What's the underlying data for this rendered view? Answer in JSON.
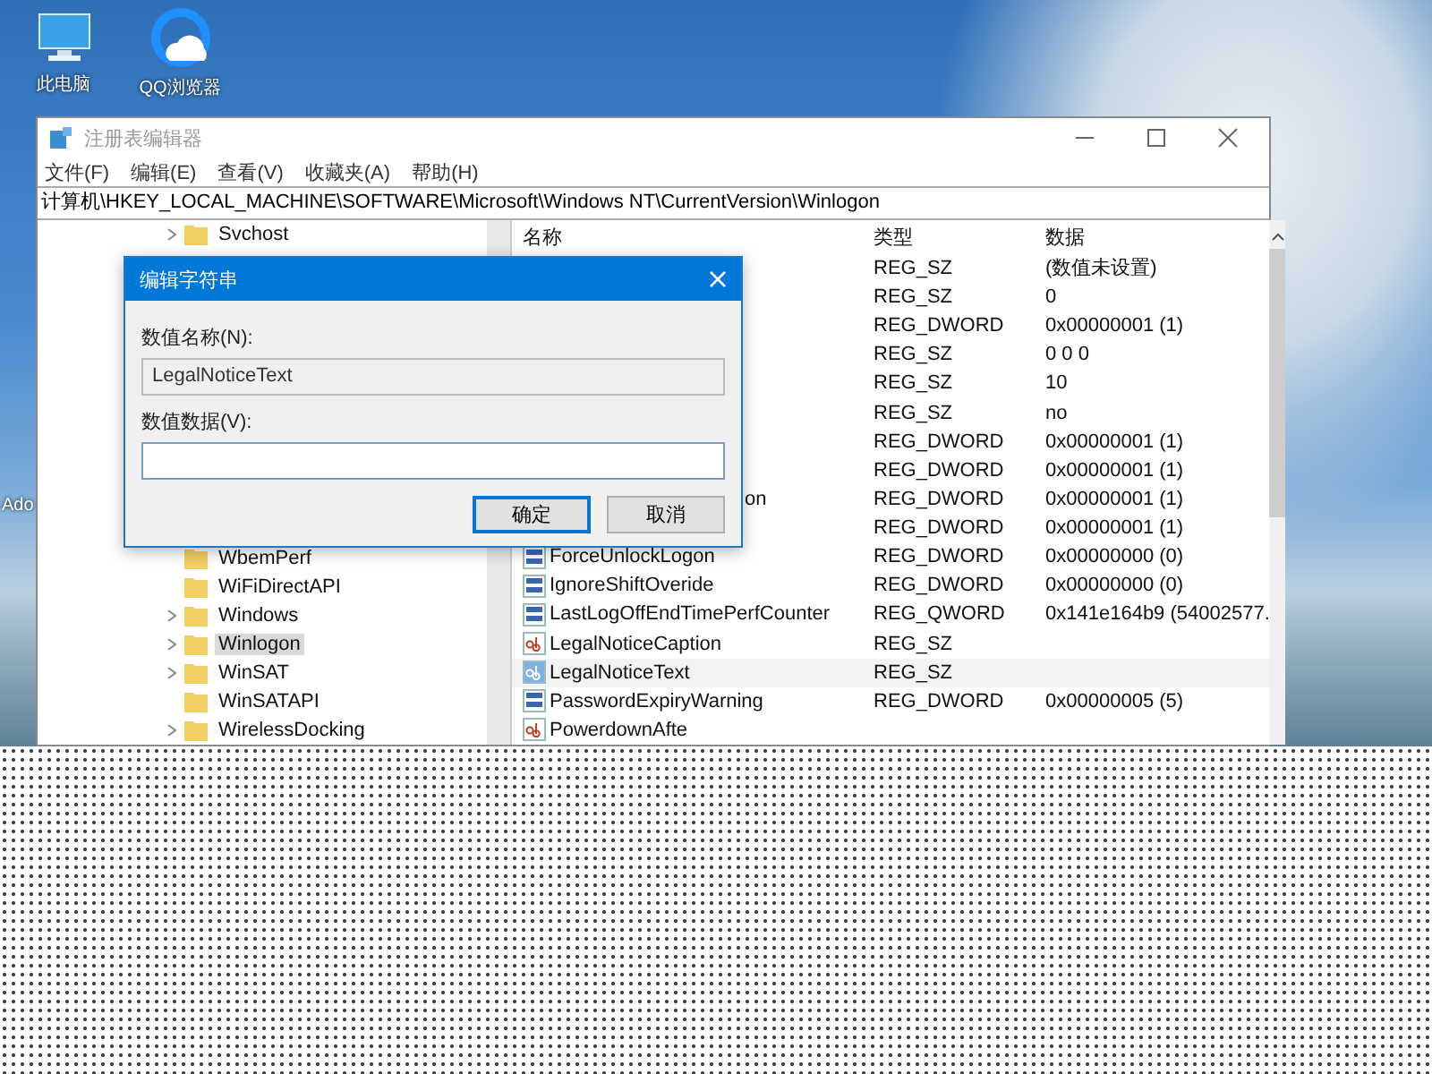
{
  "desktop": {
    "icons": [
      {
        "label": "此电脑",
        "kind": "computer"
      },
      {
        "label": "QQ浏览器",
        "kind": "browser"
      }
    ],
    "edge_label": "Ado"
  },
  "window": {
    "title": "注册表编辑器"
  },
  "menu": [
    "文件(F)",
    "编辑(E)",
    "查看(V)",
    "收藏夹(A)",
    "帮助(H)"
  ],
  "address": "计算机\\HKEY_LOCAL_MACHINE\\SOFTWARE\\Microsoft\\Windows NT\\CurrentVersion\\Winlogon",
  "tree": {
    "top": [
      {
        "label": "Svchost",
        "expandable": true,
        "selected": false
      }
    ],
    "bottom": [
      {
        "label": "WbemPerf",
        "expandable": false,
        "selected": false
      },
      {
        "label": "WiFiDirectAPI",
        "expandable": false,
        "selected": false
      },
      {
        "label": "Windows",
        "expandable": true,
        "selected": false
      },
      {
        "label": "Winlogon",
        "expandable": true,
        "selected": true
      },
      {
        "label": "WinSAT",
        "expandable": true,
        "selected": false
      },
      {
        "label": "WinSATAPI",
        "expandable": false,
        "selected": false
      },
      {
        "label": "WirelessDocking",
        "expandable": true,
        "selected": false
      }
    ]
  },
  "list": {
    "columns": [
      "名称",
      "类型",
      "数据"
    ],
    "rows": [
      {
        "kind": "hidden",
        "type": "REG_SZ",
        "data": "(数值未设置)",
        "selected": false
      },
      {
        "kind": "hidden",
        "type": "REG_SZ",
        "data": "0",
        "selected": false
      },
      {
        "kind": "hidden",
        "type": "REG_DWORD",
        "data": "0x00000001 (1)",
        "selected": false
      },
      {
        "kind": "hidden",
        "type": "REG_SZ",
        "data": "0 0 0",
        "selected": false
      },
      {
        "kind": "hidden",
        "type": "REG_SZ",
        "data": "10",
        "selected": false
      },
      {
        "kind": "hidden",
        "type": "REG_SZ",
        "data": "no",
        "selected": false
      },
      {
        "kind": "hidden",
        "type": "REG_DWORD",
        "data": "0x00000001 (1)",
        "selected": false
      },
      {
        "kind": "hidden",
        "type": "REG_DWORD",
        "data": "0x00000001 (1)",
        "selected": false
      },
      {
        "kind": "partial",
        "name": "on",
        "type": "REG_DWORD",
        "data": "0x00000001 (1)",
        "selected": false
      },
      {
        "kind": "hidden",
        "type": "REG_DWORD",
        "data": "0x00000001 (1)",
        "selected": false
      },
      {
        "kind": "number",
        "name": "ForceUnlockLogon",
        "type": "REG_DWORD",
        "data": "0x00000000 (0)",
        "selected": false
      },
      {
        "kind": "number",
        "name": "IgnoreShiftOveride",
        "type": "REG_DWORD",
        "data": "0x00000000 (0)",
        "selected": false
      },
      {
        "kind": "number",
        "name": "LastLogOffEndTimePerfCounter",
        "type": "REG_QWORD",
        "data": "0x141e164b9 (54002577.",
        "selected": false
      },
      {
        "kind": "string",
        "name": "LegalNoticeCaption",
        "type": "REG_SZ",
        "selected": false
      },
      {
        "kind": "string",
        "name": "LegalNoticeText",
        "type": "REG_SZ",
        "selected": true
      },
      {
        "kind": "number",
        "name": "PasswordExpiryWarning",
        "type": "REG_DWORD",
        "data": "0x00000005 (5)",
        "selected": false
      },
      {
        "kind": "string",
        "name": "PowerdownAfte",
        "selected": false
      }
    ]
  },
  "dialog": {
    "title": "编辑字符串",
    "name_label": "数值名称(N):",
    "name_value": "LegalNoticeText",
    "data_label": "数值数据(V):",
    "buttons": [
      {
        "label": "确定",
        "default": true
      },
      {
        "label": "取消",
        "default": false
      }
    ]
  }
}
